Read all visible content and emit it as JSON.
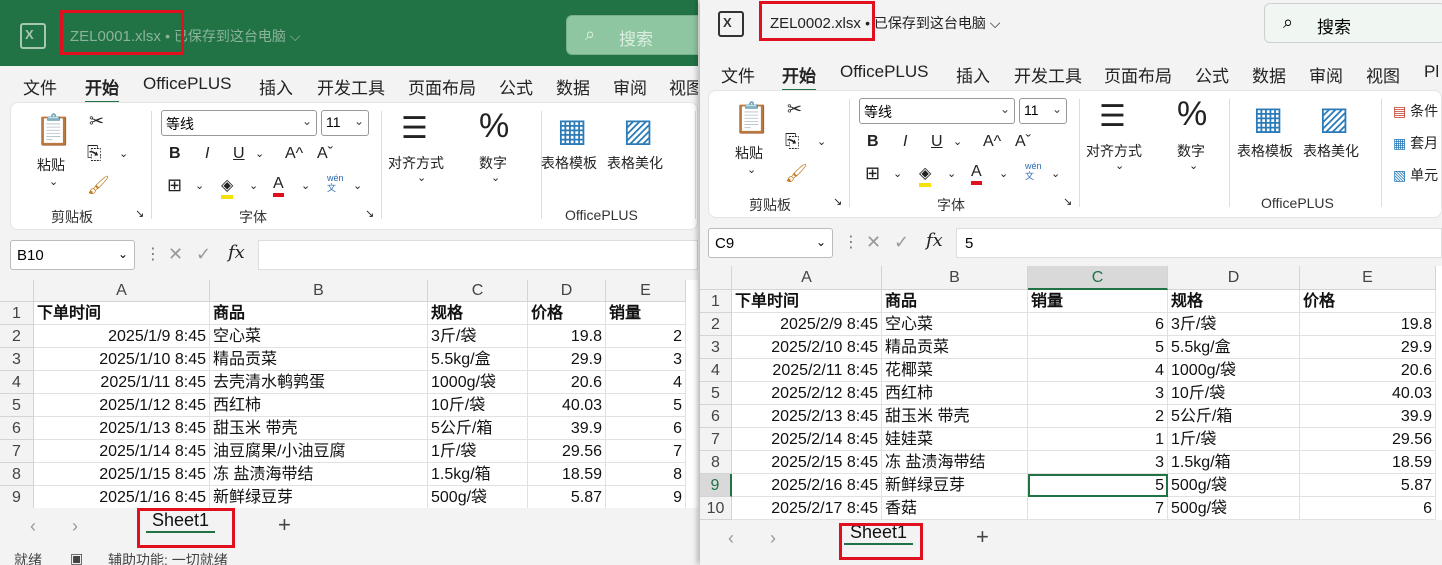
{
  "left": {
    "app_logo": "X",
    "filename": "ZEL0001.xlsx",
    "save_status": "• 已保存到这台电脑 ⌵",
    "search_label": "搜索",
    "menu": [
      "文件",
      "开始",
      "OfficePLUS",
      "插入",
      "开发工具",
      "页面布局",
      "公式",
      "数据",
      "审阅",
      "视图"
    ],
    "ribbon": {
      "paste": "粘贴",
      "clipboard_group": "剪贴板",
      "font_name": "等线",
      "font_size": "11",
      "font_group": "字体",
      "align": "对齐方式",
      "number": "数字",
      "template": "表格模板",
      "beautify": "表格美化",
      "officeplus_group": "OfficePLUS",
      "bold": "B",
      "italic": "I",
      "underline": "U",
      "grow": "A^",
      "shrink": "Aˇ",
      "wen": "wén\n文"
    },
    "name_box": "B10",
    "formula": "",
    "columns": [
      "A",
      "B",
      "C",
      "D",
      "E"
    ],
    "rows": [
      "1",
      "2",
      "3",
      "4",
      "5",
      "6",
      "7",
      "8",
      "9"
    ],
    "cells": [
      [
        "下单时间",
        "商品",
        "规格",
        "价格",
        "销量"
      ],
      [
        "2025/1/9 8:45",
        "空心菜",
        "3斤/袋",
        "19.8",
        "2"
      ],
      [
        "2025/1/10 8:45",
        "精品贡菜",
        "5.5kg/盒",
        "29.9",
        "3"
      ],
      [
        "2025/1/11 8:45",
        "去壳清水鹌鹑蛋",
        "1000g/袋",
        "20.6",
        "4"
      ],
      [
        "2025/1/12 8:45",
        "西红柿",
        "10斤/袋",
        "40.03",
        "5"
      ],
      [
        "2025/1/13 8:45",
        "甜玉米 带壳",
        "5公斤/箱",
        "39.9",
        "6"
      ],
      [
        "2025/1/14 8:45",
        "油豆腐果/小油豆腐",
        "1斤/袋",
        "29.56",
        "7"
      ],
      [
        "2025/1/15 8:45",
        "冻 盐渍海带结",
        "1.5kg/箱",
        "18.59",
        "8"
      ],
      [
        "2025/1/16 8:45",
        "新鲜绿豆芽",
        "500g/袋",
        "5.87",
        "9"
      ]
    ],
    "sheet_tab": "Sheet1",
    "status_ready": "就绪",
    "status_access": "辅助功能: 一切就绪"
  },
  "right": {
    "app_logo": "X",
    "filename": "ZEL0002.xlsx",
    "save_status": "• 已保存到这台电脑 ⌵",
    "search_label": "搜索",
    "menu": [
      "文件",
      "开始",
      "OfficePLUS",
      "插入",
      "开发工具",
      "页面布局",
      "公式",
      "数据",
      "审阅",
      "视图",
      "Pl"
    ],
    "ribbon": {
      "paste": "粘贴",
      "clipboard_group": "剪贴板",
      "font_name": "等线",
      "font_size": "11",
      "font_group": "字体",
      "align": "对齐方式",
      "number": "数字",
      "template": "表格模板",
      "beautify": "表格美化",
      "officeplus_group": "OfficePLUS",
      "cond": "条件",
      "table_fmt": "套月",
      "cell_style": "单元",
      "bold": "B",
      "italic": "I",
      "underline": "U",
      "grow": "A^",
      "shrink": "Aˇ",
      "wen": "wén\n文"
    },
    "name_box": "C9",
    "formula": "5",
    "columns": [
      "A",
      "B",
      "C",
      "D",
      "E"
    ],
    "rows": [
      "1",
      "2",
      "3",
      "4",
      "5",
      "6",
      "7",
      "8",
      "9",
      "10"
    ],
    "cells": [
      [
        "下单时间",
        "商品",
        "销量",
        "规格",
        "价格"
      ],
      [
        "2025/2/9 8:45",
        "空心菜",
        "6",
        "3斤/袋",
        "19.8"
      ],
      [
        "2025/2/10 8:45",
        "精品贡菜",
        "5",
        "5.5kg/盒",
        "29.9"
      ],
      [
        "2025/2/11 8:45",
        "花椰菜",
        "4",
        "1000g/袋",
        "20.6"
      ],
      [
        "2025/2/12 8:45",
        "西红柿",
        "3",
        "10斤/袋",
        "40.03"
      ],
      [
        "2025/2/13 8:45",
        "甜玉米 带壳",
        "2",
        "5公斤/箱",
        "39.9"
      ],
      [
        "2025/2/14 8:45",
        "娃娃菜",
        "1",
        "1斤/袋",
        "29.56"
      ],
      [
        "2025/2/15 8:45",
        "冻 盐渍海带结",
        "3",
        "1.5kg/箱",
        "18.59"
      ],
      [
        "2025/2/16 8:45",
        "新鲜绿豆芽",
        "5",
        "500g/袋",
        "5.87"
      ],
      [
        "2025/2/17 8:45",
        "香菇",
        "7",
        "500g/袋",
        "6"
      ]
    ],
    "sheet_tab": "Sheet1"
  },
  "colors": {
    "excel_green": "#217346",
    "highlight_red": "#e0101e"
  }
}
